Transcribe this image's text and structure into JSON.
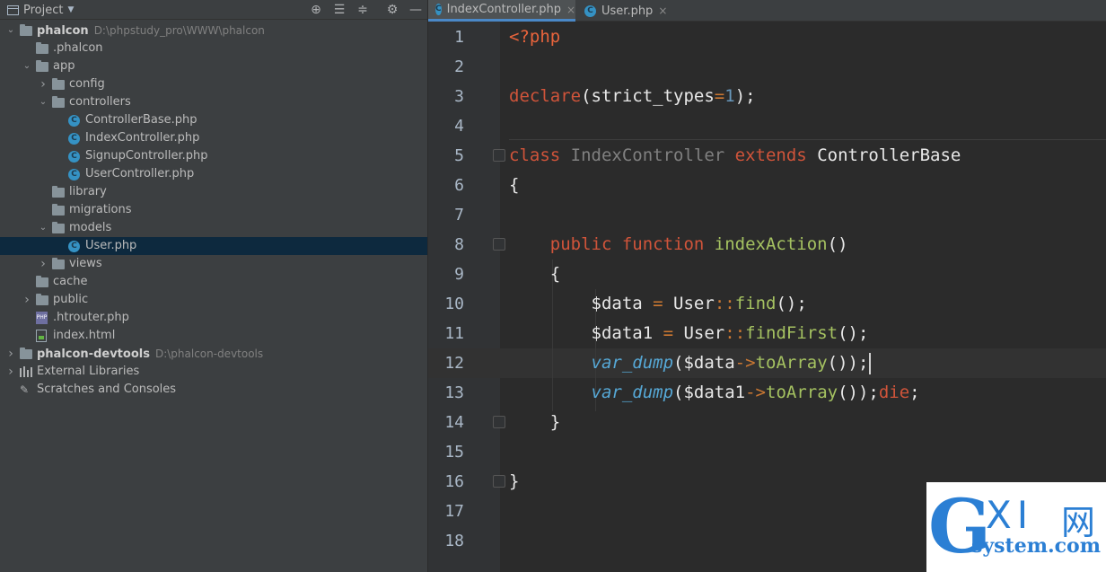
{
  "project_panel": {
    "title": "Project",
    "tree": [
      {
        "label": "phalcon",
        "path": "D:\\phpstudy_pro\\WWW\\phalcon",
        "type": "project",
        "depth": 0,
        "expanded": true,
        "bold": true
      },
      {
        "label": ".phalcon",
        "type": "folder",
        "depth": 1,
        "expanded": null
      },
      {
        "label": "app",
        "type": "folder",
        "depth": 1,
        "expanded": true
      },
      {
        "label": "config",
        "type": "folder",
        "depth": 2,
        "expanded": false
      },
      {
        "label": "controllers",
        "type": "folder",
        "depth": 2,
        "expanded": true
      },
      {
        "label": "ControllerBase.php",
        "type": "class",
        "depth": 3
      },
      {
        "label": "IndexController.php",
        "type": "class",
        "depth": 3
      },
      {
        "label": "SignupController.php",
        "type": "class",
        "depth": 3
      },
      {
        "label": "UserController.php",
        "type": "class",
        "depth": 3
      },
      {
        "label": "library",
        "type": "folder",
        "depth": 2,
        "expanded": null
      },
      {
        "label": "migrations",
        "type": "folder",
        "depth": 2,
        "expanded": null
      },
      {
        "label": "models",
        "type": "folder",
        "depth": 2,
        "expanded": true
      },
      {
        "label": "User.php",
        "type": "class",
        "depth": 3,
        "selected": true
      },
      {
        "label": "views",
        "type": "folder",
        "depth": 2,
        "expanded": false
      },
      {
        "label": "cache",
        "type": "folder",
        "depth": 1,
        "expanded": null
      },
      {
        "label": "public",
        "type": "folder",
        "depth": 1,
        "expanded": false
      },
      {
        "label": ".htrouter.php",
        "type": "php",
        "depth": 1
      },
      {
        "label": "index.html",
        "type": "html",
        "depth": 1
      },
      {
        "label": "phalcon-devtools",
        "path": "D:\\phalcon-devtools",
        "type": "project",
        "depth": 0,
        "expanded": false,
        "bold": true
      },
      {
        "label": "External Libraries",
        "type": "libraries",
        "depth": 0,
        "expanded": false
      },
      {
        "label": "Scratches and Consoles",
        "type": "scratches",
        "depth": 0,
        "expanded": null
      }
    ]
  },
  "editor": {
    "tabs": [
      {
        "label": "IndexController.php",
        "active": true
      },
      {
        "label": "User.php",
        "active": false
      }
    ],
    "caret_line": 12,
    "lines": [
      [
        {
          "t": "<?php",
          "c": "tag"
        }
      ],
      [],
      [
        {
          "t": "declare",
          "c": "kp"
        },
        {
          "t": "(strict_types",
          "c": "var"
        },
        {
          "t": "=",
          "c": "op"
        },
        {
          "t": "1",
          "c": "n"
        },
        {
          "t": ");",
          "c": "var"
        }
      ],
      [],
      [
        {
          "t": "class ",
          "c": "kp"
        },
        {
          "t": "IndexController ",
          "c": "dim"
        },
        {
          "t": "extends ",
          "c": "kp"
        },
        {
          "t": "ControllerBase",
          "c": "var"
        }
      ],
      [
        {
          "t": "{",
          "c": "var"
        }
      ],
      [],
      [
        {
          "t": "    "
        },
        {
          "t": "public ",
          "c": "kp"
        },
        {
          "t": "function ",
          "c": "kp"
        },
        {
          "t": "indexAction",
          "c": "fg"
        },
        {
          "t": "()",
          "c": "var"
        }
      ],
      [
        {
          "t": "    "
        },
        {
          "t": "{",
          "c": "var"
        }
      ],
      [
        {
          "t": "        "
        },
        {
          "t": "$data ",
          "c": "var"
        },
        {
          "t": "= ",
          "c": "op"
        },
        {
          "t": "User",
          "c": "var"
        },
        {
          "t": "::",
          "c": "op"
        },
        {
          "t": "find",
          "c": "fg"
        },
        {
          "t": "();",
          "c": "var"
        }
      ],
      [
        {
          "t": "        "
        },
        {
          "t": "$data1 ",
          "c": "var"
        },
        {
          "t": "= ",
          "c": "op"
        },
        {
          "t": "User",
          "c": "var"
        },
        {
          "t": "::",
          "c": "op"
        },
        {
          "t": "findFirst",
          "c": "fg"
        },
        {
          "t": "();",
          "c": "var"
        }
      ],
      [
        {
          "t": "        "
        },
        {
          "t": "var_dump",
          "c": "it"
        },
        {
          "t": "($data",
          "c": "var"
        },
        {
          "t": "->",
          "c": "op"
        },
        {
          "t": "toArray",
          "c": "fg"
        },
        {
          "t": "());",
          "c": "var"
        },
        {
          "t": "",
          "c": "cursor"
        }
      ],
      [
        {
          "t": "        "
        },
        {
          "t": "var_dump",
          "c": "it"
        },
        {
          "t": "($data1",
          "c": "var"
        },
        {
          "t": "->",
          "c": "op"
        },
        {
          "t": "toArray",
          "c": "fg"
        },
        {
          "t": "());",
          "c": "var"
        },
        {
          "t": "die",
          "c": "kp"
        },
        {
          "t": ";",
          "c": "var"
        }
      ],
      [
        {
          "t": "    "
        },
        {
          "t": "}",
          "c": "var"
        }
      ],
      [],
      [
        {
          "t": "}",
          "c": "var"
        }
      ],
      [],
      []
    ]
  },
  "watermark": {
    "g": "G",
    "xi": "XI",
    "net": "网",
    "sub": "system.com"
  }
}
